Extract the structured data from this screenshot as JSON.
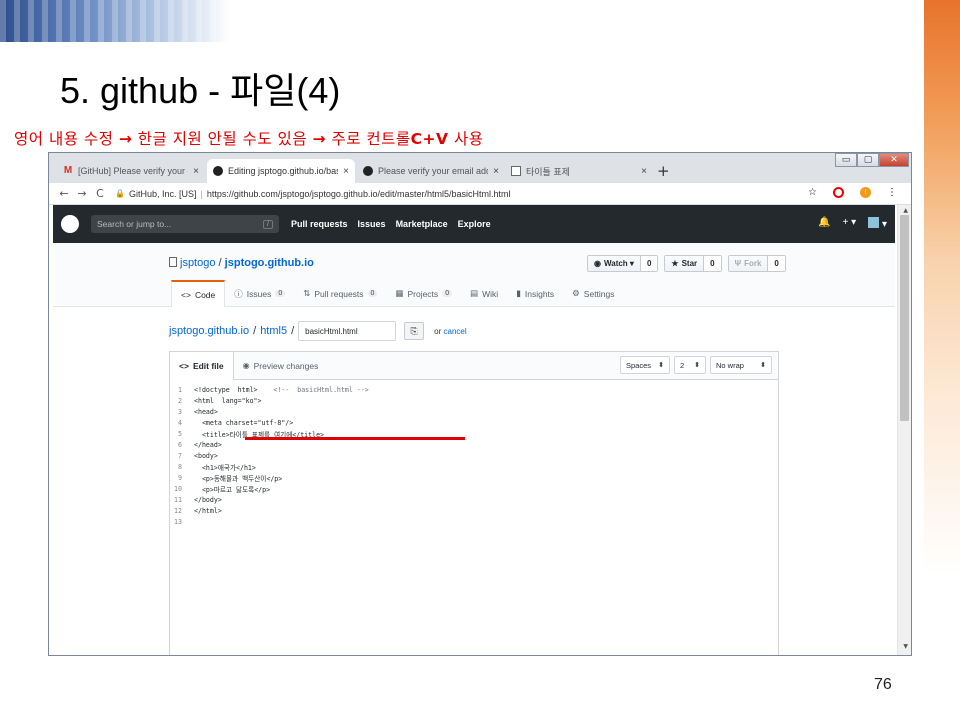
{
  "slide": {
    "title": "5. github - 파일(4)",
    "subtitle_parts": [
      "영어 내용 수정 ",
      "→",
      " 한글 지원 안될 수도 있음 ",
      "→",
      " 주로 컨트롤",
      "C+V",
      " 사용"
    ],
    "page_number": "76"
  },
  "browser": {
    "tabs": [
      {
        "label": "[GitHub] Please verify your ema",
        "icon": "gmail-icon",
        "close": "×"
      },
      {
        "label": "Editing jsptogo.github.io/basic·",
        "icon": "github-icon",
        "close": "×"
      },
      {
        "label": "Please verify your email address",
        "icon": "github-icon",
        "close": "×"
      },
      {
        "label": "타이틀 표제",
        "icon": "document-icon",
        "close": "×"
      }
    ],
    "new_tab": "+",
    "window_buttons": {
      "minimize": "▭",
      "restore": "▢",
      "close": "✕"
    },
    "nav": {
      "back": "←",
      "forward": "→",
      "reload": "C"
    },
    "address": {
      "lock": "🔒",
      "origin": "GitHub, Inc. [US]",
      "separator": "|",
      "url": "https://github.com/jsptogo/jsptogo.github.io/edit/master/html5/basicHtml.html"
    },
    "toolbar_right": {
      "star": "☆",
      "profile_letter": "!",
      "menu": "⋮"
    }
  },
  "github": {
    "search_placeholder": "Search or jump to...",
    "search_key": "/",
    "nav": [
      "Pull requests",
      "Issues",
      "Marketplace",
      "Explore"
    ],
    "right_icons": {
      "bell": "🔔",
      "plus": "+ ▾",
      "avatar": "▾"
    },
    "repo": {
      "owner": "jsptogo",
      "slash": "/",
      "name": "jsptogo.github.io"
    },
    "actions": [
      {
        "label": "Watch ▾",
        "icon": "eye-icon",
        "count": "0"
      },
      {
        "label": "Star",
        "icon": "star-icon",
        "count": "0"
      },
      {
        "label": "Fork",
        "icon": "fork-icon",
        "count": "0"
      }
    ],
    "repo_tabs": [
      {
        "label": "Code",
        "icon": "<>",
        "count": ""
      },
      {
        "label": "Issues",
        "icon": "ⓘ",
        "count": "0"
      },
      {
        "label": "Pull requests",
        "icon": "⇅",
        "count": "0"
      },
      {
        "label": "Projects",
        "icon": "▦",
        "count": "0"
      },
      {
        "label": "Wiki",
        "icon": "▤",
        "count": ""
      },
      {
        "label": "Insights",
        "icon": "▮",
        "count": ""
      },
      {
        "label": "Settings",
        "icon": "⚙",
        "count": ""
      }
    ],
    "breadcrumb": {
      "repo": "jsptogo.github.io",
      "dir": "html5",
      "sep": "/",
      "filename": "basicHtml.html",
      "or": "or",
      "cancel": "cancel"
    },
    "editor": {
      "tabs": [
        {
          "label": "Edit file",
          "icon": "<>"
        },
        {
          "label": "Preview changes",
          "icon": "👁"
        }
      ],
      "indent_mode": "Spaces",
      "indent_size": "2",
      "wrap_mode": "No wrap",
      "lines": [
        {
          "n": "1",
          "code": "<!doctype  html>    ",
          "comment": "<!--  basicHtml.html -->"
        },
        {
          "n": "2",
          "code": "<html  lang=\"ko\">",
          "comment": ""
        },
        {
          "n": "3",
          "code": "<head>",
          "comment": ""
        },
        {
          "n": "4",
          "code": "  <meta charset=\"utf-8\"/>",
          "comment": ""
        },
        {
          "n": "5",
          "code": "  <title>타이틀 표제를 여기에</title>",
          "comment": ""
        },
        {
          "n": "6",
          "code": "</head>",
          "comment": ""
        },
        {
          "n": "7",
          "code": "<body>",
          "comment": ""
        },
        {
          "n": "8",
          "code": "  <h1>애국가</h1>",
          "comment": ""
        },
        {
          "n": "9",
          "code": "  <p>동해물과 백두산이</p>",
          "comment": ""
        },
        {
          "n": "10",
          "code": "  <p>마르고 닳도록</p>",
          "comment": ""
        },
        {
          "n": "11",
          "code": "</body>",
          "comment": ""
        },
        {
          "n": "12",
          "code": "</html>",
          "comment": ""
        },
        {
          "n": "13",
          "code": "",
          "comment": ""
        }
      ]
    }
  },
  "colors": {
    "highlight_red": "#e00000",
    "github_header": "#24292e",
    "link_blue": "#0366d6",
    "active_tab_accent": "#e36209"
  }
}
